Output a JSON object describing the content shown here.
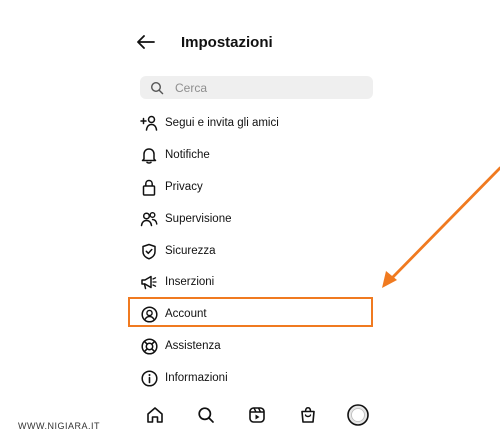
{
  "header": {
    "title": "Impostazioni",
    "back_icon": "arrow-left-icon"
  },
  "search": {
    "placeholder": "Cerca",
    "value": ""
  },
  "menu": [
    {
      "label": "Segui e invita gli amici",
      "icon": "add-person-icon"
    },
    {
      "label": "Notifiche",
      "icon": "bell-icon"
    },
    {
      "label": "Privacy",
      "icon": "lock-icon"
    },
    {
      "label": "Supervisione",
      "icon": "people-icon"
    },
    {
      "label": "Sicurezza",
      "icon": "shield-icon"
    },
    {
      "label": "Inserzioni",
      "icon": "megaphone-icon"
    },
    {
      "label": "Account",
      "icon": "account-circle-icon",
      "highlighted": true
    },
    {
      "label": "Assistenza",
      "icon": "lifebuoy-icon"
    },
    {
      "label": "Informazioni",
      "icon": "info-icon"
    }
  ],
  "bottom_nav": [
    "home-icon",
    "search-icon",
    "reels-icon",
    "shop-icon",
    "profile-avatar"
  ],
  "annotation": {
    "color": "#f07a20"
  },
  "watermark": "WWW.NIGIARA.IT"
}
